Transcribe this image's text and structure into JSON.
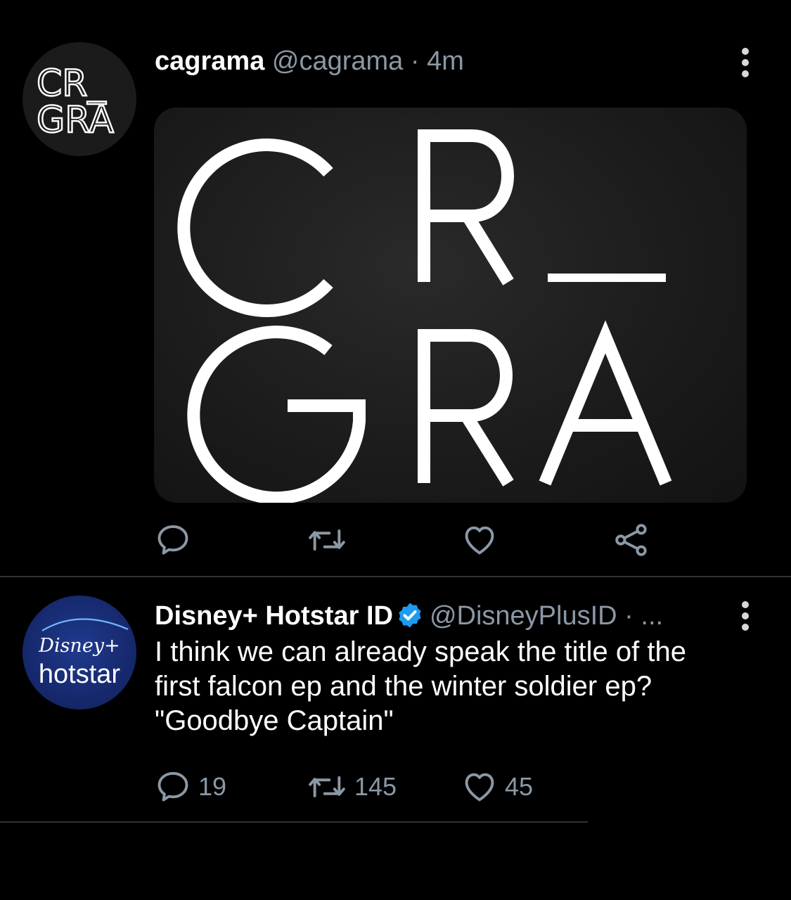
{
  "tweets": [
    {
      "avatar_text": [
        "CR_",
        "GRA"
      ],
      "display_name": "cagrama",
      "handle": "@cagrama",
      "separator": "·",
      "time": "4m",
      "media_text": [
        "CR_",
        "GRA"
      ],
      "actions": {
        "reply": {
          "icon": "reply-icon",
          "count": ""
        },
        "retweet": {
          "icon": "retweet-icon",
          "count": ""
        },
        "like": {
          "icon": "heart-icon",
          "count": ""
        },
        "share": {
          "icon": "share-icon"
        }
      }
    },
    {
      "avatar_text": [
        "Disney+",
        "hotstar"
      ],
      "display_name": "Disney+ Hotstar ID",
      "verified": true,
      "handle": "@DisneyPlusID",
      "separator": "·",
      "time": "...",
      "text_lines": [
        "I think we can already speak the title of the",
        "first falcon ep and the winter soldier ep?",
        "\"Goodbye Captain\""
      ],
      "actions": {
        "reply": {
          "icon": "reply-icon",
          "count": "19"
        },
        "retweet": {
          "icon": "retweet-icon",
          "count": "145"
        },
        "like": {
          "icon": "heart-icon",
          "count": "45"
        }
      }
    }
  ],
  "colors": {
    "background": "#000000",
    "secondary_text": "#8b98a5",
    "verified_badge": "#1d9bf0",
    "divider": "#2f3336",
    "hotstar_blue": "#17296e"
  }
}
